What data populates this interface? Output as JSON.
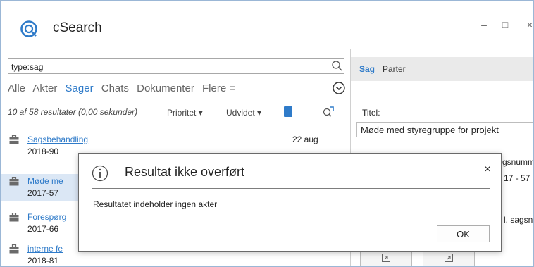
{
  "app": {
    "title": "cSearch"
  },
  "window": {
    "minimize": "–",
    "maximize": "□",
    "close": "×"
  },
  "search": {
    "value": "type:sag"
  },
  "filters": [
    "Alle",
    "Akter",
    "Sager",
    "Chats",
    "Dokumenter",
    "Flere ="
  ],
  "filters_active": "Sager",
  "results_summary": {
    "count_text": "10 af 58 resultater (0,00 sekunder)",
    "sort_priority": "Prioritet ▾",
    "sort_expanded": "Udvidet ▾"
  },
  "results": [
    {
      "title": "Sagsbehandling",
      "number": "2018-90",
      "date": "22 aug"
    },
    {
      "title": "Møde me",
      "number": "2017-57",
      "date": ""
    },
    {
      "title": "Forespørg",
      "number": "2017-66",
      "date": ""
    },
    {
      "title": "interne fe",
      "number": "2018-81",
      "date": ""
    }
  ],
  "right_pane": {
    "tabs": [
      "Sag",
      "Parter"
    ],
    "title_label": "Titel:",
    "title_value": "Møde med styregruppe for projekt",
    "frag1": "gsnumm",
    "frag2": "17 - 57",
    "frag3": "l. sagsn"
  },
  "dialog": {
    "title": "Resultat ikke overført",
    "close": "×",
    "message": "Resultatet indeholder ingen akter",
    "ok": "OK"
  },
  "colors": {
    "accent": "#2f7bc9",
    "selected_row": "#dbe7f5"
  }
}
